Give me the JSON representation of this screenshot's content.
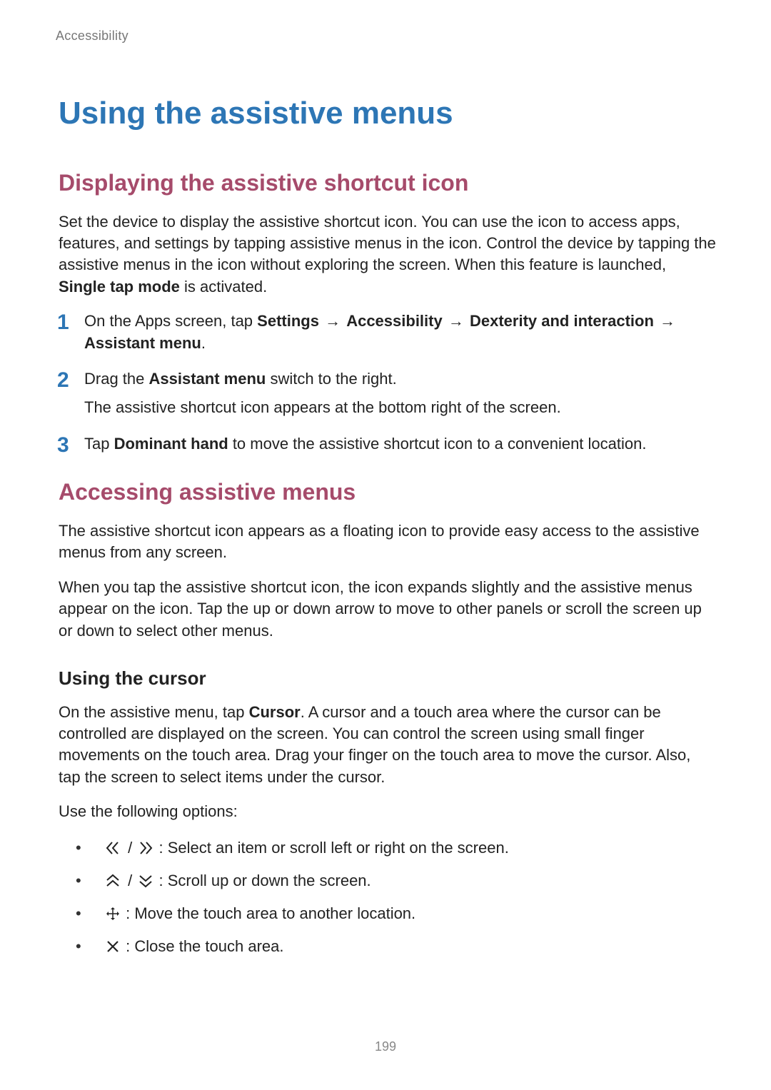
{
  "running_head": "Accessibility",
  "title": "Using the assistive menus",
  "sec1": {
    "heading": "Displaying the assistive shortcut icon",
    "intro_part1": "Set the device to display the assistive shortcut icon. You can use the icon to access apps, features, and settings by tapping assistive menus in the icon. Control the device by tapping the assistive menus in the icon without exploring the screen. When this feature is launched, ",
    "intro_bold": "Single tap mode",
    "intro_part2": " is activated.",
    "steps": {
      "s1_pre": "On the Apps screen, tap ",
      "s1_b1": "Settings",
      "s1_b2": "Accessibility",
      "s1_b3": "Dexterity and interaction",
      "s1_b4": "Assistant menu",
      "s1_end": ".",
      "arrow": "→",
      "s2_pre": "Drag the ",
      "s2_b": "Assistant menu",
      "s2_post": " switch to the right.",
      "s2_note": "The assistive shortcut icon appears at the bottom right of the screen.",
      "s3_pre": "Tap ",
      "s3_b": "Dominant hand",
      "s3_post": " to move the assistive shortcut icon to a convenient location."
    }
  },
  "sec2": {
    "heading": "Accessing assistive menus",
    "p1": "The assistive shortcut icon appears as a floating icon to provide easy access to the assistive menus from any screen.",
    "p2": "When you tap the assistive shortcut icon, the icon expands slightly and the assistive menus appear on the icon. Tap the up or down arrow to move to other panels or scroll the screen up or down to select other menus.",
    "sub": {
      "heading": "Using the cursor",
      "p1_pre": "On the assistive menu, tap ",
      "p1_b": "Cursor",
      "p1_post": ". A cursor and a touch area where the cursor can be controlled are displayed on the screen. You can control the screen using small finger movements on the touch area. Drag your finger on the touch area to move the cursor. Also, tap the screen to select items under the cursor.",
      "p2": "Use the following options:",
      "slash": "/",
      "li1": " : Select an item or scroll left or right on the screen.",
      "li2": " : Scroll up or down the screen.",
      "li3": " : Move the touch area to another location.",
      "li4": " : Close the touch area."
    }
  },
  "page_number": "199"
}
